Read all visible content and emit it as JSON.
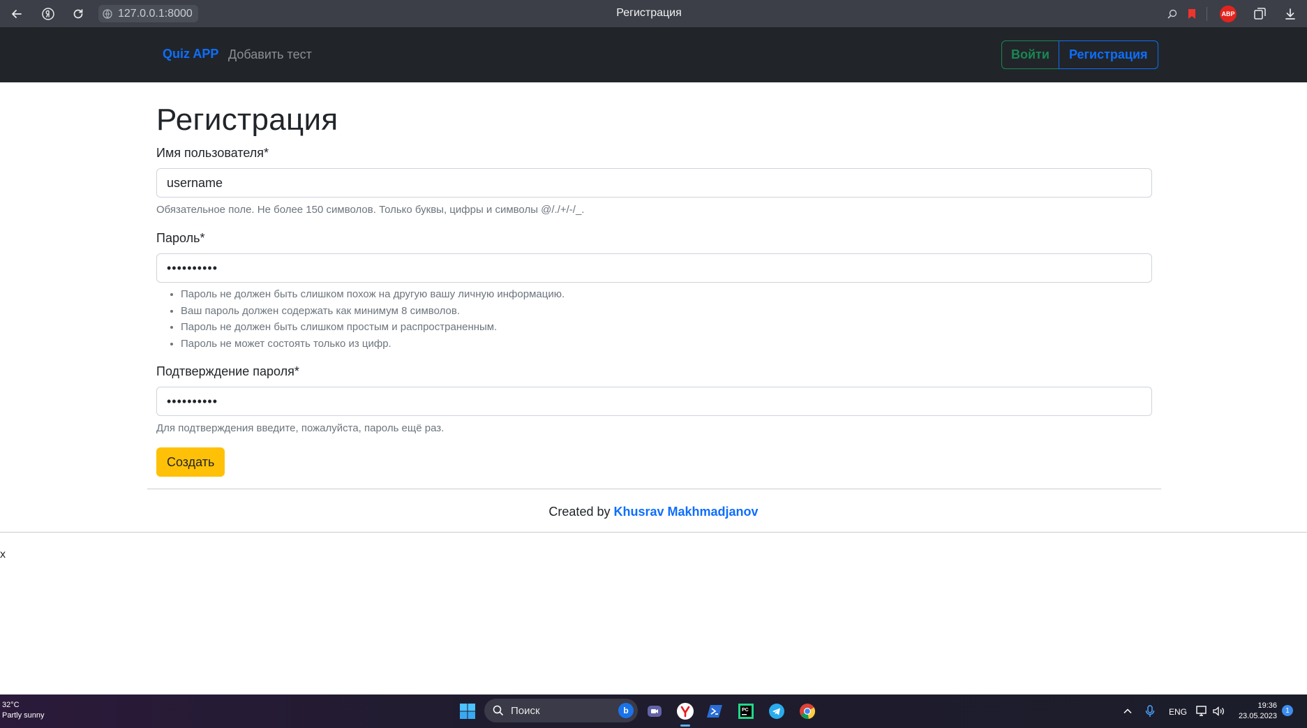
{
  "browser": {
    "url": "127.0.0.1:8000",
    "tab_title": "Регистрация",
    "extension_badge": "ABP"
  },
  "navbar": {
    "brand": "Quiz APP",
    "add_test_link": "Добавить тест",
    "login_button": "Войти",
    "register_button": "Регистрация"
  },
  "form": {
    "title": "Регистрация",
    "username": {
      "label": "Имя пользователя*",
      "value": "username",
      "help": "Обязательное поле. Не более 150 символов. Только буквы, цифры и символы @/./+/-/_."
    },
    "password": {
      "label": "Пароль*",
      "value": "••••••••••",
      "rules": [
        "Пароль не должен быть слишком похож на другую вашу личную информацию.",
        "Ваш пароль должен содержать как минимум 8 символов.",
        "Пароль не должен быть слишком простым и распространенным.",
        "Пароль не может состоять только из цифр."
      ]
    },
    "password_confirm": {
      "label": "Подтверждение пароля*",
      "value": "••••••••••",
      "help": "Для подтверждения введите, пожалуйста, пароль ещё раз."
    },
    "submit_button": "Создать"
  },
  "footer": {
    "created_by": "Created by",
    "author": "Khusrav Makhmadjanov"
  },
  "stray_text": "x",
  "taskbar": {
    "weather_temp": "32°C",
    "weather_desc": "Partly sunny",
    "search_placeholder": "Поиск",
    "language": "ENG",
    "time": "19:36",
    "date": "23.05.2023",
    "notification_count": "1"
  },
  "colors": {
    "primary": "#0d6efd",
    "success": "#198754",
    "warning": "#ffc107",
    "navbar_bg": "#212529"
  }
}
